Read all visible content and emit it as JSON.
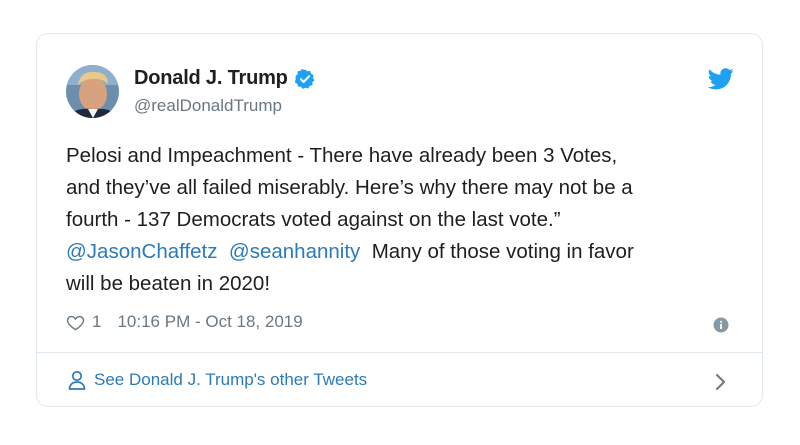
{
  "author": {
    "display_name": "Donald J. Trump",
    "handle": "@realDonaldTrump",
    "verified_icon": "verified-badge-icon"
  },
  "tweet": {
    "text_line_1": "Pelosi and Impeachment - There have already been 3 Votes,",
    "text_line_2": "and they’ve all failed miserably. Here’s why there may not be a",
    "text_line_3": "fourth - 137 Democrats voted against on the last vote.”",
    "mention_1": "@JasonChaffetz",
    "mention_2": "@seanhannity",
    "text_line_4_rest": "Many of those voting in favor",
    "text_line_5": "will be beaten in 2020!"
  },
  "meta": {
    "like_count": "1",
    "timestamp": "10:16 PM - Oct 18, 2019"
  },
  "footer": {
    "see_more_label": "See Donald J. Trump's other Tweets"
  },
  "colors": {
    "link_blue": "#2b7bb9",
    "twitter_blue": "#1da1f2",
    "muted_gray": "#697882",
    "border": "#e1e8ed"
  }
}
